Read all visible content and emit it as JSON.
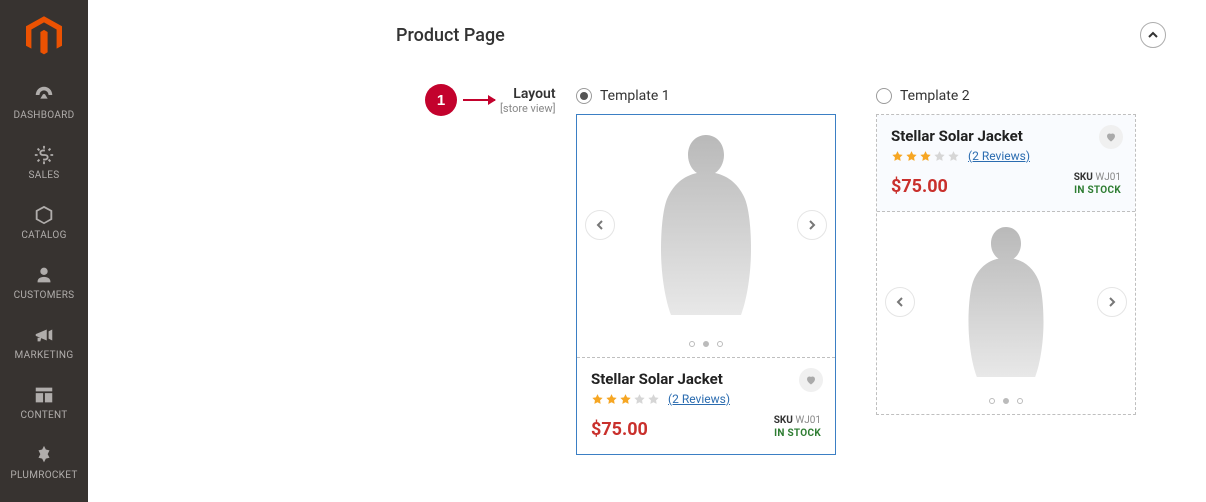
{
  "sidebar": {
    "items": [
      {
        "label": "DASHBOARD"
      },
      {
        "label": "SALES"
      },
      {
        "label": "CATALOG"
      },
      {
        "label": "CUSTOMERS"
      },
      {
        "label": "MARKETING"
      },
      {
        "label": "CONTENT"
      },
      {
        "label": "PLUMROCKET"
      }
    ]
  },
  "section": {
    "title": "Product Page"
  },
  "annotation": {
    "number": "1"
  },
  "field": {
    "label": "Layout",
    "scope": "[store view]"
  },
  "options": {
    "template1": {
      "radio_label": "Template 1",
      "selected": true,
      "product": {
        "name": "Stellar Solar Jacket",
        "reviews_label": "(2 Reviews)",
        "rating_stars": 3,
        "price": "$75.00",
        "sku_label": "SKU",
        "sku_value": "WJ01",
        "stock": "IN STOCK"
      }
    },
    "template2": {
      "radio_label": "Template 2",
      "selected": false,
      "product": {
        "name": "Stellar Solar Jacket",
        "reviews_label": "(2 Reviews)",
        "rating_stars": 3,
        "price": "$75.00",
        "sku_label": "SKU",
        "sku_value": "WJ01",
        "stock": "IN STOCK"
      }
    }
  }
}
